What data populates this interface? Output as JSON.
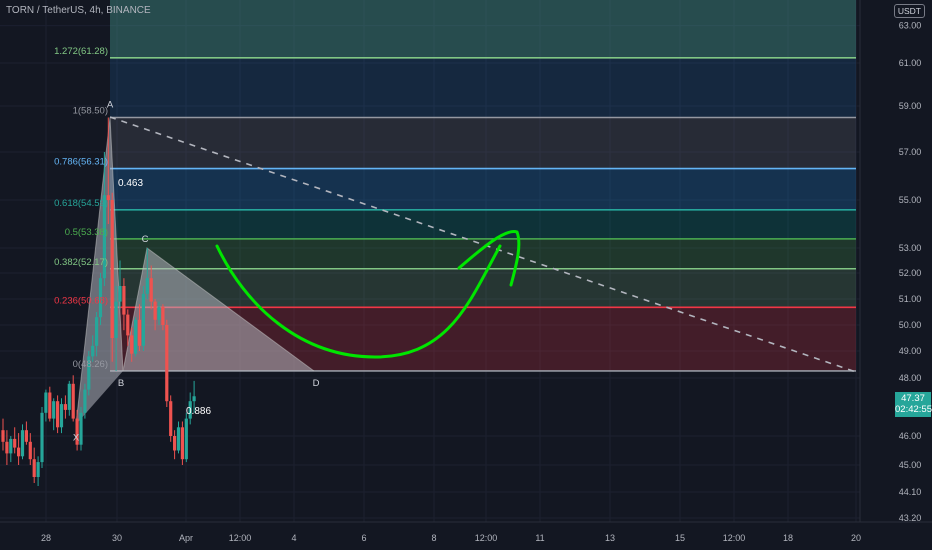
{
  "header": {
    "symbol": "TORN / TetherUS, 4h, BINANCE",
    "currency_button": "USDT"
  },
  "chart_data": {
    "type": "candlestick",
    "price_axis": {
      "ylim": [
        43.0,
        64.8
      ],
      "ticks": [
        "63.00",
        "61.00",
        "59.00",
        "57.00",
        "55.00",
        "53.00",
        "52.00",
        "51.00",
        "50.00",
        "49.00",
        "48.00",
        "46.00",
        "45.00",
        "44.10",
        "43.20"
      ]
    },
    "time_axis": {
      "ticks": [
        "28",
        "30",
        "Apr",
        "12:00",
        "4",
        "6",
        "8",
        "12:00",
        "11",
        "13",
        "15",
        "12:00",
        "18",
        "20"
      ]
    },
    "last_price": {
      "value": "47.37",
      "countdown": "02:42:55",
      "color": "#26a69a"
    },
    "fib_levels": [
      {
        "label": "1.272(61.28)",
        "price": 61.28,
        "color": "#81c784"
      },
      {
        "label": "1(58.50)",
        "price": 58.5,
        "color": "#9598a1"
      },
      {
        "label": "0.786(56.31)",
        "price": 56.31,
        "color": "#64b5f6"
      },
      {
        "label": "0.618(54.59)",
        "price": 54.59,
        "color": "#26a69a"
      },
      {
        "label": "0.5(53.38)",
        "price": 53.38,
        "color": "#4caf50"
      },
      {
        "label": "0.382(52.17)",
        "price": 52.17,
        "color": "#81c784"
      },
      {
        "label": "0.236(50.68)",
        "price": 50.68,
        "color": "#f23645"
      },
      {
        "label": "0(48.26)",
        "price": 48.26,
        "color": "#9598a1"
      }
    ],
    "pattern": {
      "points": [
        {
          "label": "X",
          "x": 0,
          "y": 46.4
        },
        {
          "label": "A",
          "x": 1,
          "y": 58.5
        },
        {
          "label": "B",
          "x": 2,
          "y": 48.26
        },
        {
          "label": "C",
          "x": 3,
          "y": 53.0
        },
        {
          "label": "D",
          "x": 4,
          "y": 48.26
        }
      ],
      "ratios": [
        "0.463",
        "0.886"
      ]
    },
    "candles": [
      [
        2,
        46.2,
        46.6,
        45.5,
        45.8
      ],
      [
        2,
        45.8,
        46.2,
        45.0,
        45.4
      ],
      [
        2,
        45.4,
        46.0,
        45.1,
        45.9
      ],
      [
        2,
        45.9,
        46.3,
        45.4,
        45.6
      ],
      [
        2,
        45.6,
        46.1,
        45.0,
        45.3
      ],
      [
        2,
        45.3,
        46.4,
        45.2,
        46.2
      ],
      [
        2,
        46.2,
        46.5,
        45.7,
        45.8
      ],
      [
        2,
        45.8,
        46.1,
        45.0,
        45.2
      ],
      [
        2,
        45.2,
        45.6,
        44.4,
        44.6
      ],
      [
        2,
        44.6,
        45.3,
        44.3,
        45.1
      ],
      [
        2,
        45.1,
        47.0,
        44.9,
        46.8
      ],
      [
        2,
        46.8,
        47.6,
        46.5,
        47.5
      ],
      [
        2,
        47.5,
        47.7,
        46.5,
        46.6
      ],
      [
        2,
        46.6,
        47.3,
        46.2,
        47.2
      ],
      [
        2,
        47.2,
        47.4,
        46.1,
        46.3
      ],
      [
        2,
        46.3,
        47.3,
        46.1,
        47.1
      ],
      [
        2,
        47.1,
        47.4,
        46.6,
        46.9
      ],
      [
        2,
        46.9,
        47.9,
        46.7,
        47.8
      ],
      [
        2,
        47.8,
        48.1,
        46.5,
        46.6
      ],
      [
        2,
        46.6,
        46.9,
        45.5,
        45.7
      ],
      [
        2,
        45.7,
        47.0,
        45.5,
        46.8
      ],
      [
        2,
        46.8,
        47.8,
        46.6,
        47.6
      ],
      [
        2,
        47.6,
        49.0,
        47.4,
        48.8
      ],
      [
        2,
        48.8,
        49.6,
        48.6,
        49.2
      ],
      [
        2,
        49.2,
        50.5,
        48.8,
        50.3
      ],
      [
        2,
        50.3,
        52.0,
        50.0,
        51.8
      ],
      [
        2,
        51.8,
        57.0,
        51.5,
        55.2
      ],
      [
        2,
        55.2,
        58.5,
        54.0,
        55.0
      ],
      [
        2,
        55.0,
        55.3,
        48.6,
        49.5
      ],
      [
        2,
        49.5,
        51.5,
        48.26,
        50.9
      ],
      [
        2,
        50.9,
        52.5,
        50.6,
        51.5
      ],
      [
        2,
        51.5,
        51.8,
        49.8,
        50.4
      ],
      [
        2,
        50.4,
        50.6,
        49.2,
        49.6
      ],
      [
        2,
        49.6,
        49.9,
        48.6,
        48.9
      ],
      [
        2,
        48.9,
        50.3,
        48.8,
        50.2
      ],
      [
        2,
        50.2,
        50.8,
        49.0,
        49.2
      ],
      [
        2,
        49.2,
        51.5,
        49.0,
        51.2
      ],
      [
        2,
        51.2,
        53.0,
        51.0,
        51.8
      ],
      [
        2,
        51.8,
        52.3,
        50.6,
        50.9
      ],
      [
        2,
        50.9,
        51.0,
        49.8,
        50.2
      ],
      [
        2,
        50.2,
        50.9,
        50.0,
        50.7
      ],
      [
        2,
        50.7,
        50.8,
        49.8,
        50.0
      ],
      [
        2,
        50.0,
        50.2,
        47.0,
        47.2
      ],
      [
        2,
        47.2,
        47.4,
        45.8,
        46.0
      ],
      [
        2,
        46.0,
        46.2,
        45.2,
        45.5
      ],
      [
        2,
        45.5,
        46.5,
        45.4,
        46.3
      ],
      [
        2,
        46.3,
        46.5,
        45.0,
        45.2
      ],
      [
        2,
        45.2,
        46.8,
        45.1,
        46.6
      ],
      [
        2,
        46.6,
        47.5,
        46.4,
        47.2
      ],
      [
        2,
        47.2,
        47.9,
        46.8,
        47.37
      ]
    ],
    "grid": true
  }
}
